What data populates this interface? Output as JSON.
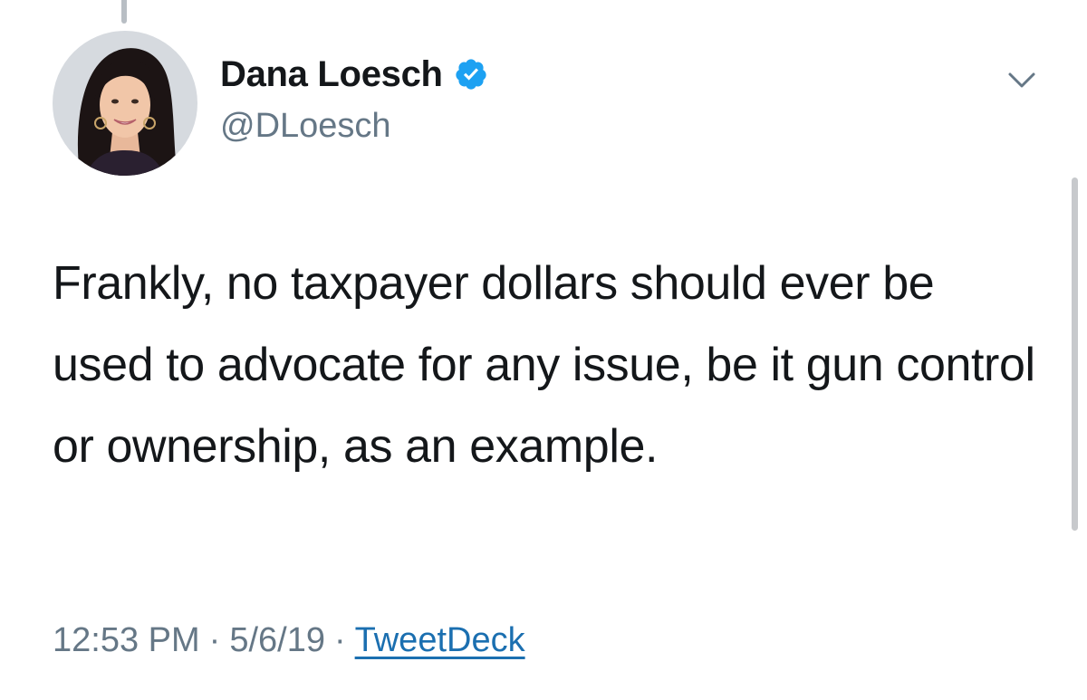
{
  "tweet": {
    "author": {
      "display_name": "Dana Loesch",
      "handle": "@DLoesch",
      "verified": true,
      "avatar_icon": "profile-photo"
    },
    "menu_icon": "chevron-down-icon",
    "text": "Frankly, no taxpayer dollars should ever be used to advocate for any issue, be it gun control or ownership, as an example.",
    "meta": {
      "time": "12:53 PM",
      "date": "5/6/19",
      "separator": "·",
      "source": "TweetDeck"
    }
  },
  "colors": {
    "text_primary": "#14171a",
    "text_secondary": "#657786",
    "verified_blue": "#1da1f2",
    "link_blue": "#1b6fb0"
  }
}
